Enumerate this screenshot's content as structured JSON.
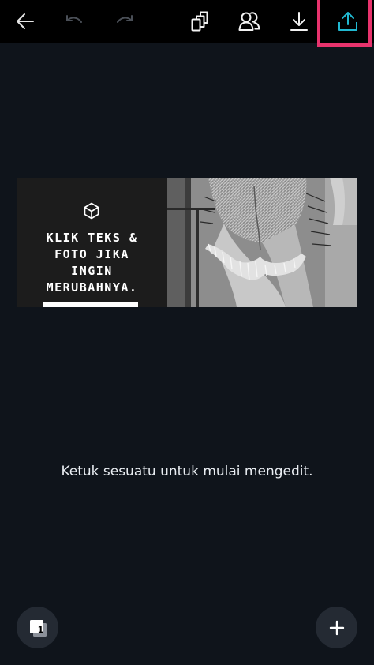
{
  "toolbar": {
    "back_icon": "arrow-left-icon",
    "undo_icon": "undo-icon",
    "redo_icon": "redo-icon",
    "copy_icon": "copy-pages-icon",
    "collaborate_icon": "people-icon",
    "download_icon": "download-icon",
    "share_icon": "share-upload-icon",
    "share_accent": "#21b8d0",
    "highlight_color": "#e8336d"
  },
  "design": {
    "icon": "cube-icon",
    "text": "KLIK TEKS &\nFOTO JIKA\nINGIN\nMERUBAHNYA.",
    "photo": "black-and-white photo of person in distressed denim shorts"
  },
  "hint": {
    "text": "Ketuk sesuatu untuk mulai mengedit."
  },
  "bottom": {
    "page_count": "1",
    "add_icon": "plus-icon"
  }
}
